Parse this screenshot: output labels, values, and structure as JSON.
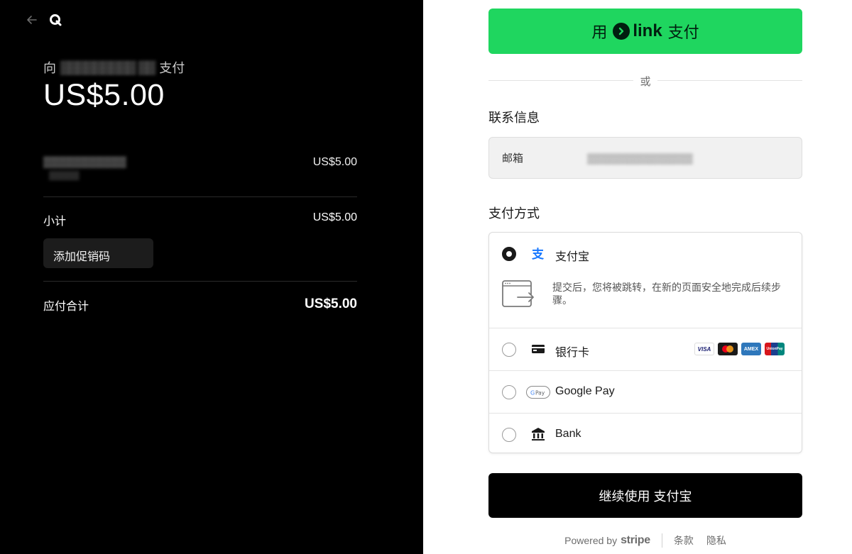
{
  "summary": {
    "pay_to_prefix": "向",
    "merchant": "▒▒▒▒▒▒▒▒▒ ▒▒",
    "pay_to_suffix": "支付",
    "amount": "US$5.00",
    "item_name": "▒▒▒▒▒▒▒▒▒▒▒",
    "item_sub": "▒▒▒▒▒",
    "item_price": "US$5.00",
    "subtotal_label": "小计",
    "subtotal_value": "US$5.00",
    "promo_label": "添加促销码",
    "total_label": "应付合计",
    "total_value": "US$5.00"
  },
  "checkout": {
    "link_prefix": "用",
    "link_brand": "link",
    "link_suffix": "支付",
    "or_text": "或",
    "contact_title": "联系信息",
    "email_label": "邮箱",
    "email_value": "▒▒▒▒▒▒▒▒▒▒▒▒▒▒▒",
    "payment_title": "支付方式",
    "methods": [
      {
        "label": "支付宝",
        "icon": "alipay-icon",
        "selected": true,
        "description": "提交后，您将被跳转，在新的页面安全地完成后续步骤。"
      },
      {
        "label": "银行卡",
        "icon": "card-icon",
        "selected": false
      },
      {
        "label": "Google Pay",
        "icon": "google-pay-icon",
        "selected": false
      },
      {
        "label": "Bank",
        "icon": "bank-icon",
        "selected": false
      }
    ],
    "card_brands": [
      "VISA",
      "",
      "AMEX",
      "UnionPay"
    ],
    "continue_label": "继续使用 支付宝",
    "footer": {
      "powered_by": "Powered by",
      "brand": "stripe",
      "terms": "条款",
      "privacy": "隐私"
    }
  },
  "colors": {
    "link_green": "#1fd65f",
    "left_bg": "#000000",
    "alipay_blue": "#1677ff"
  }
}
